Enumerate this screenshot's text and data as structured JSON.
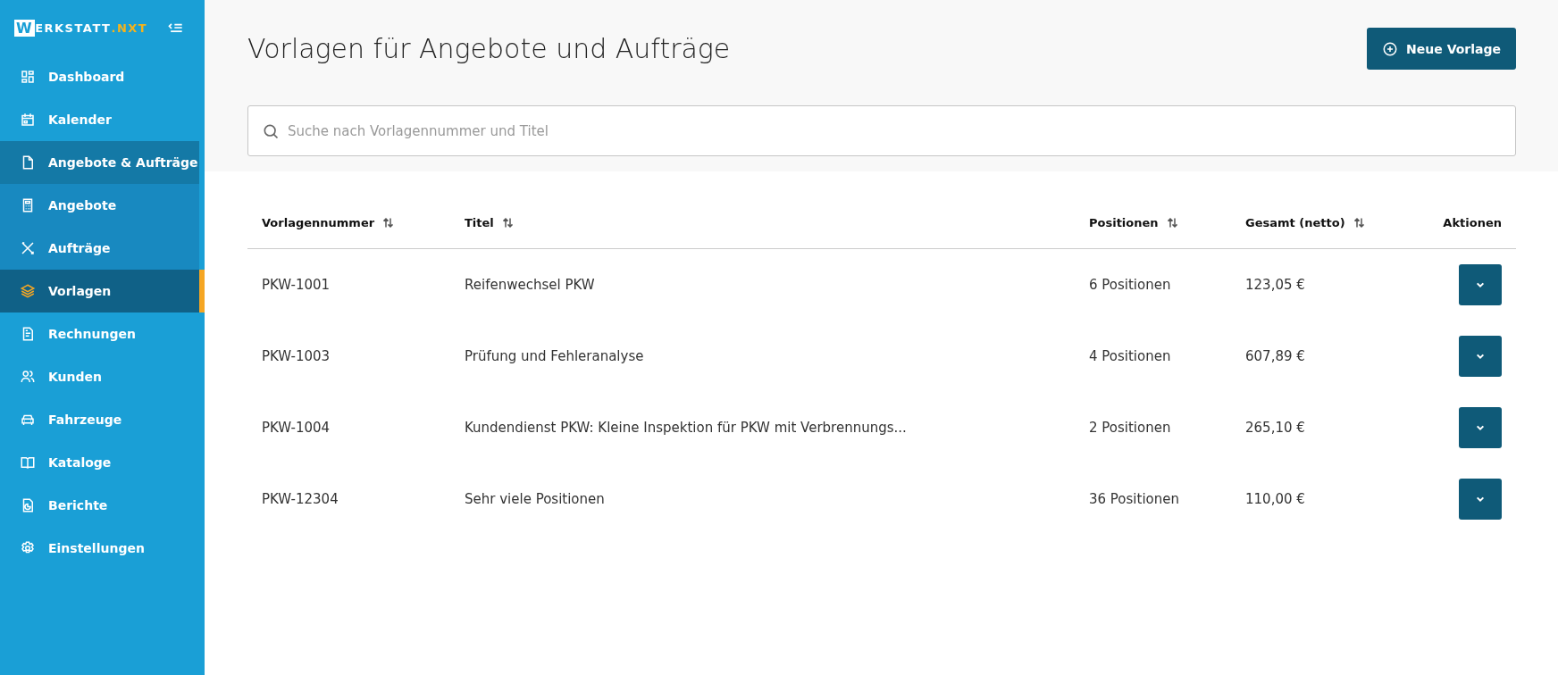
{
  "sidebar": {
    "logo": {
      "letter": "W",
      "text": "ERKSTATT",
      "suffix": ".NXT"
    },
    "items": [
      {
        "label": "Dashboard",
        "selected": false
      },
      {
        "label": "Kalender",
        "selected": false
      },
      {
        "label": "Angebote & Aufträge",
        "selected": false,
        "expanded": true,
        "children": [
          {
            "label": "Angebote",
            "selected": false
          },
          {
            "label": "Aufträge",
            "selected": false
          },
          {
            "label": "Vorlagen",
            "selected": true
          }
        ]
      },
      {
        "label": "Rechnungen",
        "selected": false
      },
      {
        "label": "Kunden",
        "selected": false
      },
      {
        "label": "Fahrzeuge",
        "selected": false
      },
      {
        "label": "Kataloge",
        "selected": false
      },
      {
        "label": "Berichte",
        "selected": false
      },
      {
        "label": "Einstellungen",
        "selected": false
      }
    ]
  },
  "page": {
    "title": "Vorlagen für Angebote und Aufträge",
    "new_button": "Neue Vorlage",
    "search": {
      "placeholder": "Suche nach Vorlagennummer und Titel"
    }
  },
  "table": {
    "columns": [
      {
        "label": "Vorlagennummer",
        "sortable": true
      },
      {
        "label": "Titel",
        "sortable": true
      },
      {
        "label": "Positionen",
        "sortable": true
      },
      {
        "label": "Gesamt (netto)",
        "sortable": true
      },
      {
        "label": "Aktionen",
        "sortable": false
      }
    ],
    "rows": [
      {
        "number": "PKW-1001",
        "title": "Reifenwechsel PKW",
        "positions": "6 Positionen",
        "total": "123,05 €"
      },
      {
        "number": "PKW-1003",
        "title": "Prüfung und Fehleranalyse",
        "positions": "4 Positionen",
        "total": "607,89 €"
      },
      {
        "number": "PKW-1004",
        "title": "Kundendienst PKW: Kleine Inspektion für PKW mit Verbrennungs...",
        "positions": "2 Positionen",
        "total": "265,10 €"
      },
      {
        "number": "PKW-12304",
        "title": "Sehr viele Positionen",
        "positions": "36 Positionen",
        "total": "110,00 €"
      }
    ]
  }
}
